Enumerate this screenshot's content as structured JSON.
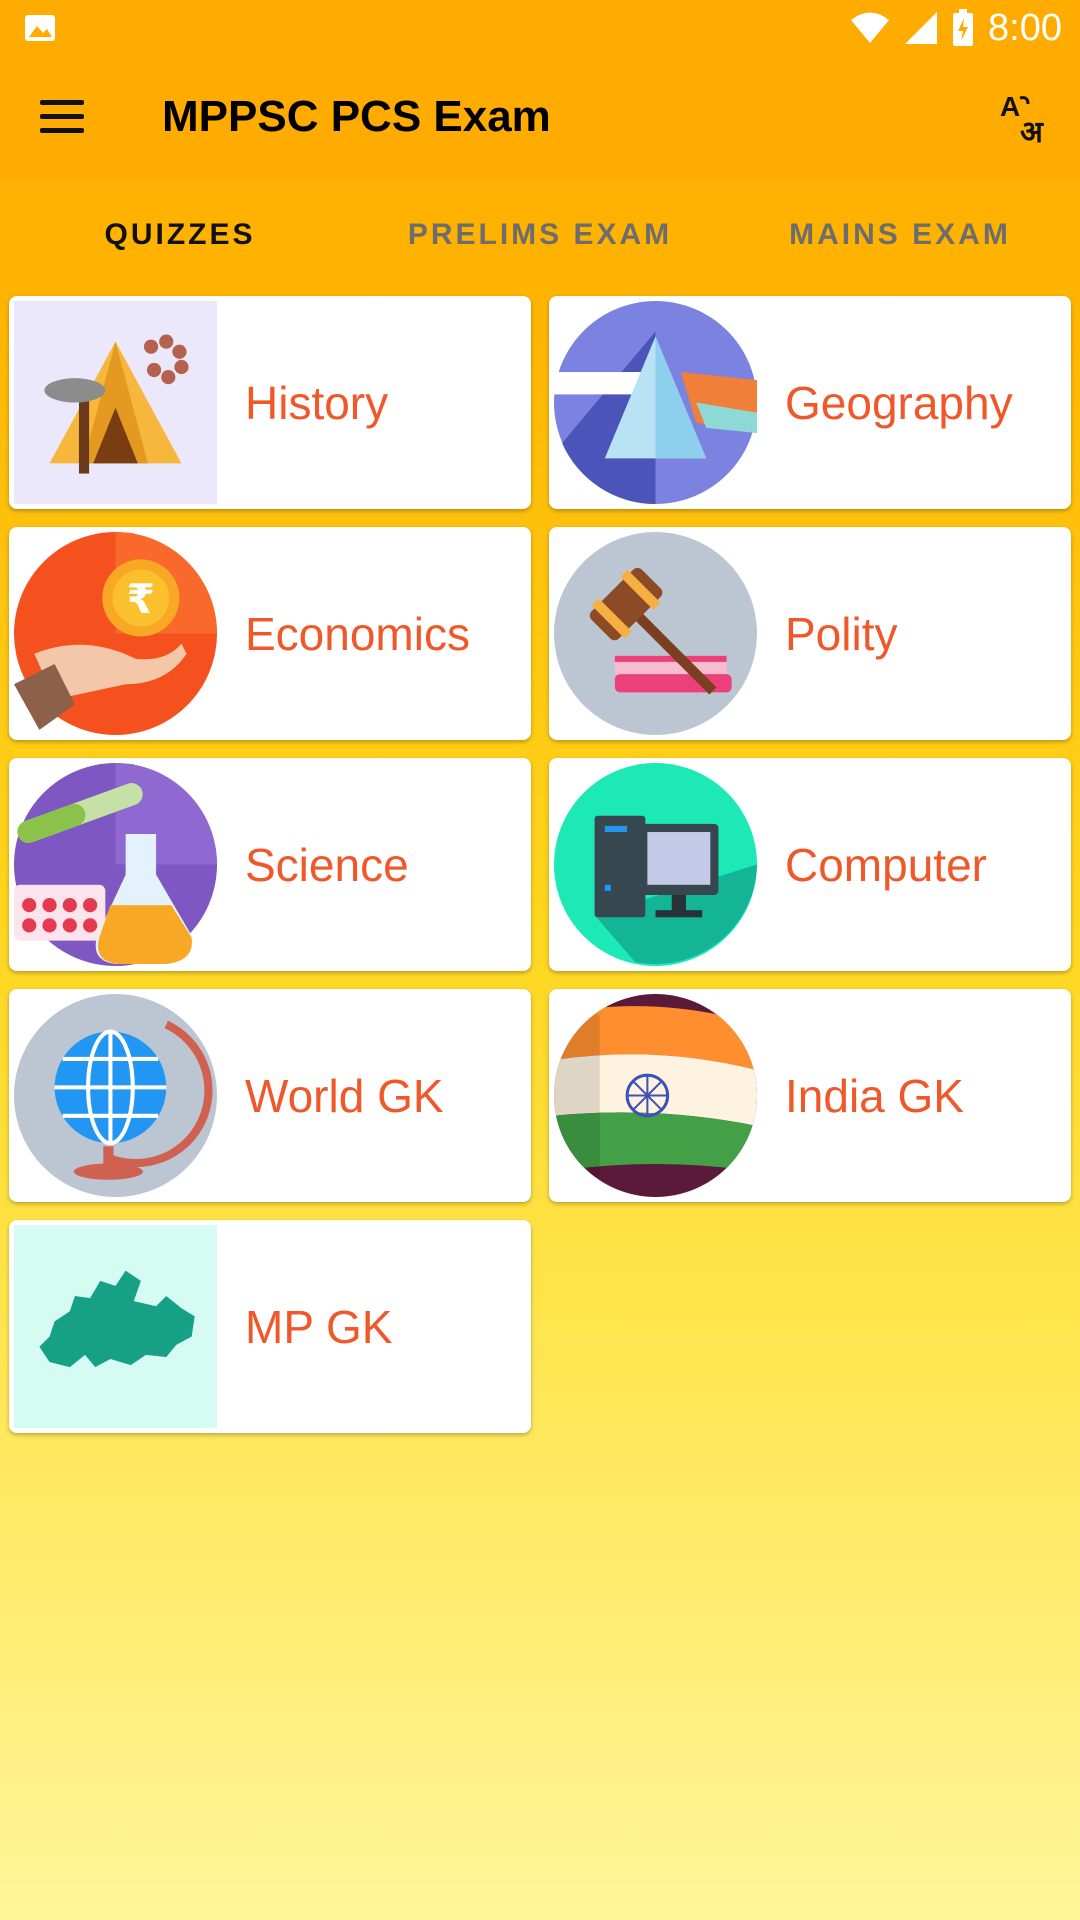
{
  "status_bar": {
    "time": "8:00"
  },
  "app_bar": {
    "title": "MPPSC PCS Exam"
  },
  "tabs": [
    {
      "label": "QUIZZES",
      "active": true
    },
    {
      "label": "PRELIMS EXAM",
      "active": false
    },
    {
      "label": "MAINS EXAM",
      "active": false
    }
  ],
  "categories": [
    {
      "label": "History",
      "icon": "history-icon"
    },
    {
      "label": "Geography",
      "icon": "geography-icon"
    },
    {
      "label": "Economics",
      "icon": "economics-icon"
    },
    {
      "label": "Polity",
      "icon": "polity-icon"
    },
    {
      "label": "Science",
      "icon": "science-icon"
    },
    {
      "label": "Computer",
      "icon": "computer-icon"
    },
    {
      "label": "World GK",
      "icon": "world-gk-icon"
    },
    {
      "label": "India GK",
      "icon": "india-gk-icon"
    },
    {
      "label": "MP GK",
      "icon": "mp-gk-icon"
    }
  ],
  "colors": {
    "accent_label": "#f0582a",
    "app_bar": "#ffab00",
    "card_background": "#ffffff"
  }
}
